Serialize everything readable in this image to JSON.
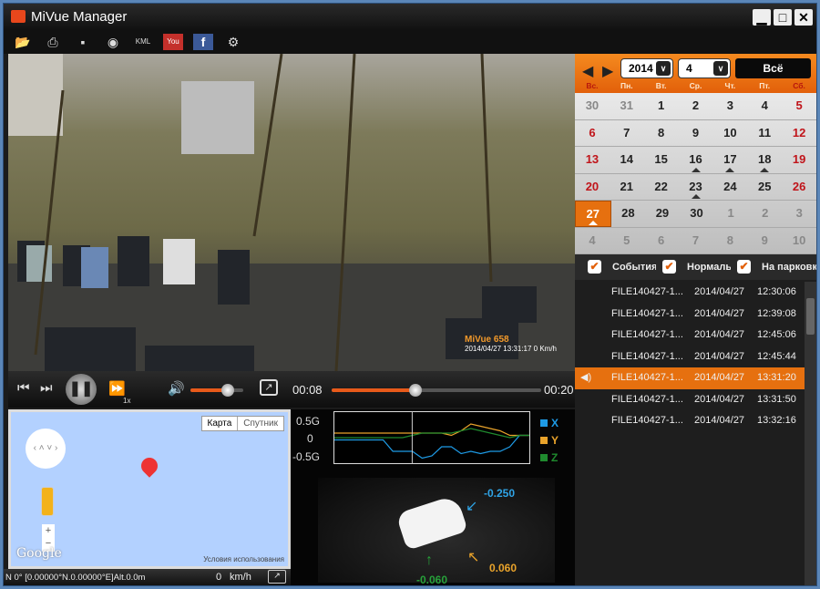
{
  "window": {
    "title": "MiVue Manager",
    "minimize": "▁",
    "maximize": "□",
    "close": "✕"
  },
  "toolbar": [
    {
      "icon": "open-folder-icon",
      "glyph": "📂"
    },
    {
      "icon": "print-icon",
      "glyph": "⎙"
    },
    {
      "icon": "save-icon",
      "glyph": "▪"
    },
    {
      "icon": "snapshot-icon",
      "glyph": "◉"
    },
    {
      "icon": "kml-export-icon",
      "glyph": "KML"
    },
    {
      "icon": "youtube-icon",
      "glyph": "You"
    },
    {
      "icon": "facebook-icon",
      "glyph": "f"
    },
    {
      "icon": "settings-icon",
      "glyph": "⚙"
    }
  ],
  "video": {
    "osd_brand": "MiVue 658",
    "osd_text": "2014/04/27 13:31:17 0 Km/h"
  },
  "player": {
    "speed": "1x",
    "current_time": "00:08",
    "total_time": "00:20",
    "progress": 0.4,
    "volume": 0.7
  },
  "map": {
    "tab_map": "Карта",
    "tab_satellite": "Спутник",
    "google": "Google",
    "terms": "Условия использования",
    "zoom_in": "+",
    "zoom_out": "−"
  },
  "status": {
    "coords": "N 0° [0.00000°N.0.00000°E]Alt.0.0m",
    "speed": "0",
    "unit": "km/h"
  },
  "chart_data": {
    "type": "line",
    "title": "G-sensor",
    "ylabel": "",
    "ytick_labels": [
      "0.5G",
      "0",
      "-0.5G"
    ],
    "ylim": [
      -0.5,
      0.5
    ],
    "cursor_fraction": 0.4,
    "x": [
      0,
      1,
      2,
      3,
      4,
      5,
      6,
      7,
      8,
      9,
      10,
      11,
      12,
      13,
      14,
      15,
      16,
      17,
      18,
      19,
      20
    ],
    "series": [
      {
        "name": "X",
        "color": "#1e9be6",
        "values": [
          -0.05,
          -0.05,
          -0.05,
          -0.05,
          -0.05,
          -0.05,
          -0.3,
          -0.3,
          -0.3,
          -0.45,
          -0.4,
          -0.2,
          -0.2,
          -0.35,
          -0.3,
          -0.35,
          -0.3,
          -0.3,
          -0.2,
          0.05,
          0.05
        ]
      },
      {
        "name": "Y",
        "color": "#e9a32b",
        "values": [
          0.1,
          0.1,
          0.1,
          0.1,
          0.1,
          0.1,
          0.1,
          0.1,
          0.1,
          0.1,
          0.1,
          0.1,
          0.05,
          0.15,
          0.3,
          0.25,
          0.2,
          0.15,
          0.05,
          0.05,
          0.05
        ]
      },
      {
        "name": "Z",
        "color": "#1f8a2e",
        "values": [
          0.0,
          0.0,
          0.0,
          0.0,
          0.0,
          0.0,
          0.0,
          0.0,
          0.05,
          0.1,
          0.1,
          0.1,
          0.1,
          0.15,
          0.2,
          0.15,
          0.1,
          0.05,
          0.0,
          0.05,
          0.05
        ]
      }
    ]
  },
  "gsensor": {
    "x": "-0.250",
    "y": "0.060",
    "z": "-0.060"
  },
  "calendar": {
    "year": "2014",
    "month": "4",
    "all_label": "Всё",
    "weekdays": [
      "Вс.",
      "Пн.",
      "Вт.",
      "Ср.",
      "Чт.",
      "Пт.",
      "Сб."
    ],
    "weeks": [
      [
        {
          "d": "30",
          "o": 1
        },
        {
          "d": "31",
          "o": 1
        },
        {
          "d": "1"
        },
        {
          "d": "2"
        },
        {
          "d": "3"
        },
        {
          "d": "4"
        },
        {
          "d": "5"
        }
      ],
      [
        {
          "d": "6"
        },
        {
          "d": "7"
        },
        {
          "d": "8"
        },
        {
          "d": "9"
        },
        {
          "d": "10"
        },
        {
          "d": "11"
        },
        {
          "d": "12"
        }
      ],
      [
        {
          "d": "13"
        },
        {
          "d": "14"
        },
        {
          "d": "15"
        },
        {
          "d": "16",
          "m": 1
        },
        {
          "d": "17",
          "m": 1
        },
        {
          "d": "18",
          "m": 1
        },
        {
          "d": "19"
        }
      ],
      [
        {
          "d": "20"
        },
        {
          "d": "21"
        },
        {
          "d": "22"
        },
        {
          "d": "23",
          "m": 1
        },
        {
          "d": "24"
        },
        {
          "d": "25"
        },
        {
          "d": "26"
        }
      ],
      [
        {
          "d": "27",
          "m": 1,
          "t": 1
        },
        {
          "d": "28"
        },
        {
          "d": "29"
        },
        {
          "d": "30"
        },
        {
          "d": "1",
          "o": 1
        },
        {
          "d": "2",
          "o": 1
        },
        {
          "d": "3",
          "o": 1
        }
      ],
      [
        {
          "d": "4",
          "o": 1
        },
        {
          "d": "5",
          "o": 1
        },
        {
          "d": "6",
          "o": 1
        },
        {
          "d": "7",
          "o": 1
        },
        {
          "d": "8",
          "o": 1
        },
        {
          "d": "9",
          "o": 1
        },
        {
          "d": "10",
          "o": 1
        }
      ]
    ]
  },
  "filters": [
    {
      "label": "События",
      "checked": true
    },
    {
      "label": "Нормальные",
      "checked": true
    },
    {
      "label": "На парковке",
      "checked": true
    }
  ],
  "files": [
    {
      "name": "FILE140427-1...",
      "date": "2014/04/27",
      "time": "12:30:06"
    },
    {
      "name": "FILE140427-1...",
      "date": "2014/04/27",
      "time": "12:39:08"
    },
    {
      "name": "FILE140427-1...",
      "date": "2014/04/27",
      "time": "12:45:06"
    },
    {
      "name": "FILE140427-1...",
      "date": "2014/04/27",
      "time": "12:45:44"
    },
    {
      "name": "FILE140427-1...",
      "date": "2014/04/27",
      "time": "13:31:20",
      "playing": true
    },
    {
      "name": "FILE140427-1...",
      "date": "2014/04/27",
      "time": "13:31:50"
    },
    {
      "name": "FILE140427-1...",
      "date": "2014/04/27",
      "time": "13:32:16"
    }
  ]
}
